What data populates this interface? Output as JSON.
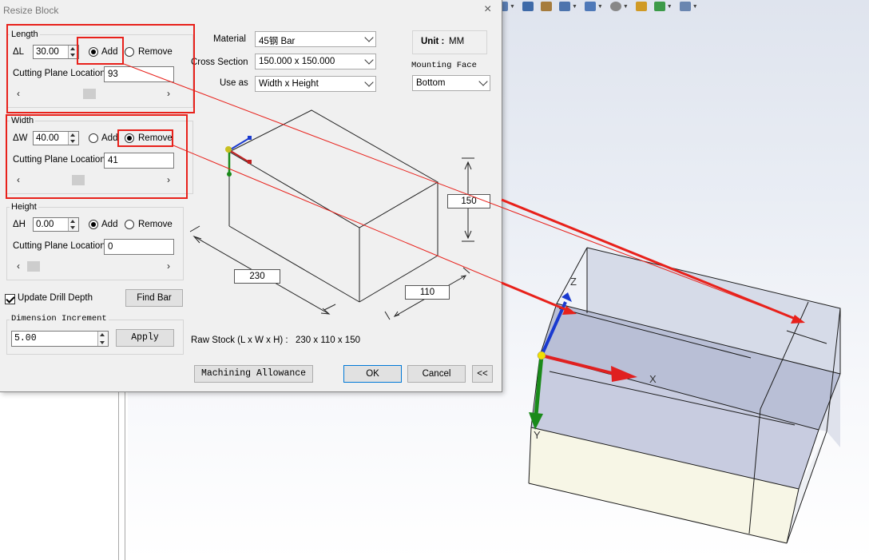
{
  "dialog": {
    "title": "Resize Block",
    "close_glyph": "×"
  },
  "length": {
    "group": "Length",
    "delta_label": "ΔL",
    "delta_value": "30.00",
    "add_label": "Add",
    "remove_label": "Remove",
    "selected": "add",
    "cutting_label": "Cutting Plane Location",
    "cutting_value": "93",
    "slider_pos": 0.45
  },
  "width": {
    "group": "Width",
    "delta_label": "ΔW",
    "delta_value": "40.00",
    "add_label": "Add",
    "remove_label": "Remove",
    "selected": "remove",
    "cutting_label": "Cutting Plane Location",
    "cutting_value": "41",
    "slider_pos": 0.38
  },
  "height": {
    "group": "Height",
    "delta_label": "ΔH",
    "delta_value": "0.00",
    "add_label": "Add",
    "remove_label": "Remove",
    "selected": "add",
    "cutting_label": "Cutting Plane Location",
    "cutting_value": "0",
    "slider_pos": 0.0
  },
  "update_drill_depth": {
    "label": "Update Drill Depth",
    "checked": true
  },
  "find_bar_label": "Find Bar",
  "dimension_increment": {
    "group": "Dimension Increment",
    "value": "5.00",
    "apply_label": "Apply"
  },
  "material": {
    "label": "Material",
    "value": "45钢 Bar"
  },
  "cross_section": {
    "label": "Cross Section",
    "value": "150.000 x 150.000"
  },
  "use_as": {
    "label": "Use as",
    "value": "Width x Height"
  },
  "unit": {
    "label": "Unit :",
    "value": "MM"
  },
  "mounting_face": {
    "label": "Mounting Face",
    "value": "Bottom"
  },
  "preview_dims": {
    "length": "230",
    "width": "110",
    "height": "150"
  },
  "raw_stock": {
    "label": "Raw Stock (L x W x H) :",
    "value": "230 x 110 x 150"
  },
  "buttons": {
    "machining_allowance": "Machining Allowance",
    "ok": "OK",
    "cancel": "Cancel",
    "collapse": "<<"
  },
  "axes": {
    "x": "X",
    "y": "Y",
    "z": "Z"
  },
  "colors": {
    "highlight": "#e8211b",
    "axis_x": "#e02020",
    "axis_y": "#1a8a1a",
    "axis_z": "#1a3ad0"
  },
  "toolbar_icons": [
    "view-orientation-icon",
    "section-view-icon",
    "display-style-icon",
    "hide-show-icon",
    "edit-appearance-icon",
    "apply-scene-icon",
    "view-settings-icon"
  ]
}
